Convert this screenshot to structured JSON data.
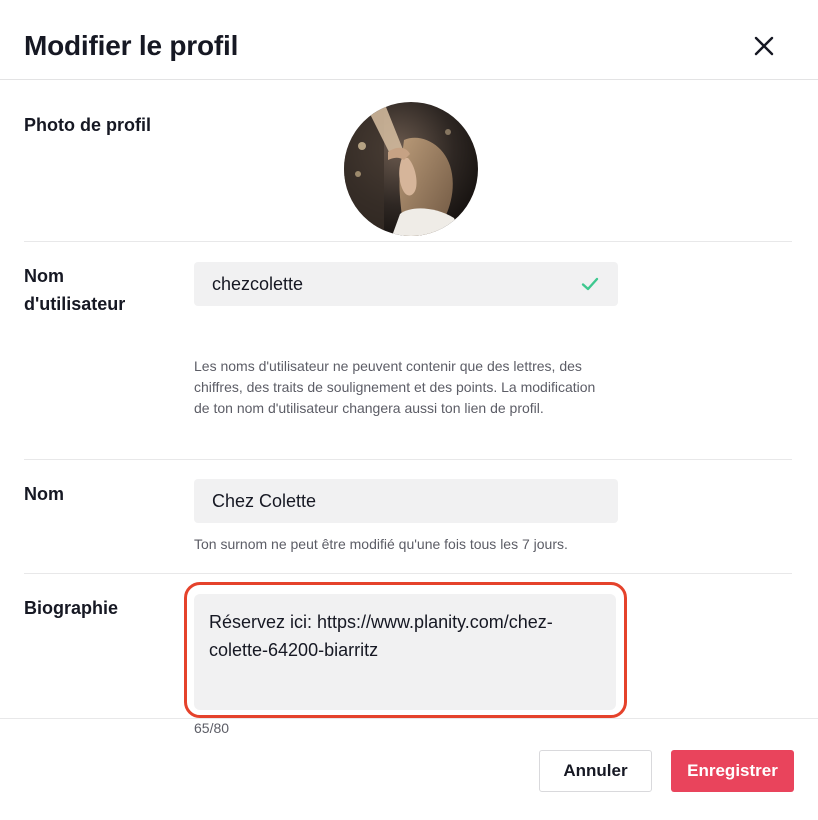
{
  "dialog": {
    "title": "Modifier le profil",
    "close_icon": "close-icon"
  },
  "profile_photo": {
    "label": "Photo de profil",
    "image": "avatar-photo"
  },
  "username": {
    "label_line1": "Nom",
    "label_line2": "d'utilisateur",
    "value": "chezcolette",
    "status_icon": "check-icon",
    "status_color": "#3ec88f",
    "hint": "Les noms d'utilisateur ne peuvent contenir que des lettres, des chiffres, des traits de soulignement et des points. La modification de ton nom d'utilisateur changera aussi ton lien de profil."
  },
  "name": {
    "label": "Nom",
    "value": "Chez Colette",
    "hint": "Ton surnom ne peut être modifié qu'une fois tous les 7 jours."
  },
  "bio": {
    "label": "Biographie",
    "value": "Réservez ici: https://www.planity.com/chez-\ncolette-64200-biarritz",
    "counter": "65/80",
    "highlight_color": "#e5422b"
  },
  "footer": {
    "cancel_label": "Annuler",
    "save_label": "Enregistrer",
    "save_color": "#e9445c"
  }
}
